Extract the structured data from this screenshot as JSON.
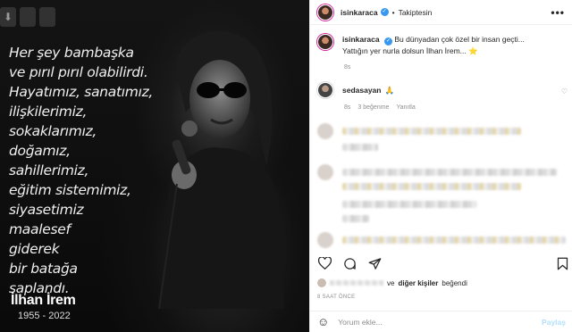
{
  "media": {
    "quote_lines": [
      "Her şey bambaşka",
      "ve pırıl pırıl olabilirdi.",
      "Hayatımız, sanatımız,",
      "ilişkilerimiz,",
      "sokaklarımız,",
      "doğamız,",
      "sahillerimiz,",
      "eğitim sistemimiz,",
      "siyasetimiz",
      "maalesef",
      "giderek",
      "bir batağa",
      "saplandı."
    ],
    "signature_name": "İlhan İrem",
    "signature_years": "1955 - 2022",
    "download_glyph": "⬇"
  },
  "header": {
    "username": "isinkaraca",
    "separator": "•",
    "follow_label": "Takiptesin",
    "more_glyph": "•••"
  },
  "caption": {
    "username": "isinkaraca",
    "line1": "Bu dünyadan çok özel bir insan geçti...",
    "line2": "Yattığın yer nurla dolsun İlhan İrem... ⭐",
    "time": "8s"
  },
  "comment": {
    "username": "sedasayan",
    "text": "🙏",
    "time": "8s",
    "likes": "3 beğenme",
    "reply": "Yanıtla"
  },
  "likes": {
    "connector": "ve",
    "others": "diğer kişiler",
    "suffix": "beğendi"
  },
  "timestamp": "8 SAAT ÖNCE",
  "composer": {
    "placeholder": "Yorum ekle...",
    "post_label": "Paylaş",
    "emoji_glyph": "☺"
  },
  "colors": {
    "verified": "#3897f0",
    "post_disabled": "#b2dffc",
    "story_ring": "#d6249f"
  }
}
